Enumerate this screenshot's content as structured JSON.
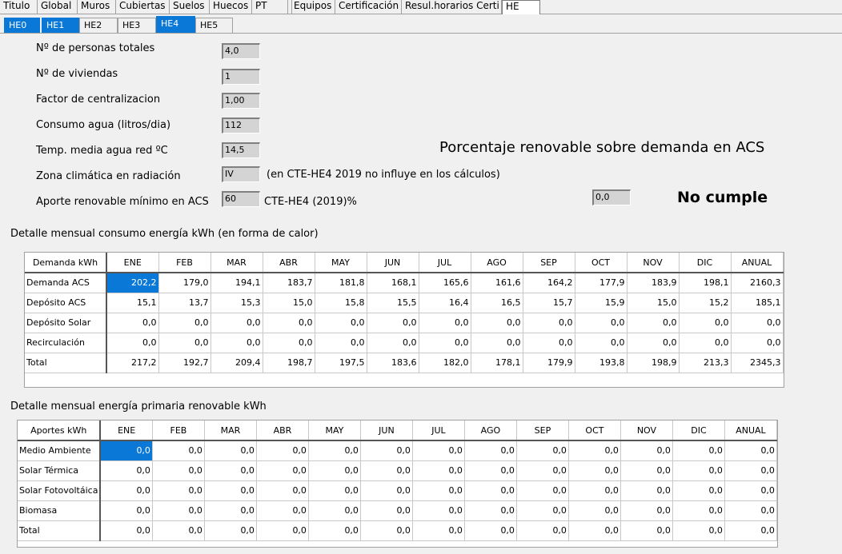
{
  "tabs_top": [
    {
      "label": "Titulo"
    },
    {
      "label": "Global"
    },
    {
      "label": "Muros"
    },
    {
      "label": "Cubiertas"
    },
    {
      "label": "Suelos"
    },
    {
      "label": "Huecos"
    },
    {
      "label": "PT"
    },
    {
      "label": ""
    },
    {
      "label": "Equipos"
    },
    {
      "label": "Certificación"
    },
    {
      "label": "Resul.horarios Certi"
    },
    {
      "label": "HE"
    }
  ],
  "tabs_he": [
    {
      "label": "HE0"
    },
    {
      "label": "HE1"
    },
    {
      "label": "HE2"
    },
    {
      "label": "HE3"
    },
    {
      "label": "HE4"
    },
    {
      "label": "HE5"
    }
  ],
  "form": {
    "personas_label": "Nº de personas totales",
    "personas_value": "4,0",
    "viviendas_label": "Nº de viviendas",
    "viviendas_value": "1",
    "factor_label": "Factor de centralizacion",
    "factor_value": "1,00",
    "consumo_label": "Consumo agua (litros/dia)",
    "consumo_value": "112",
    "temp_label": "Temp. media agua red ºC",
    "temp_value": "14,5",
    "zona_label": "Zona climática en radiación",
    "zona_value": "IV",
    "zona_note": "(en CTE-HE4 2019 no influye en los cálculos)",
    "aporte_label": "Aporte renovable mínimo en ACS",
    "aporte_value": "60",
    "aporte_note": "CTE-HE4 (2019)%"
  },
  "result": {
    "title": "Porcentaje renovable sobre demanda en ACS",
    "value": "0,0",
    "status": "No cumple"
  },
  "table1": {
    "title": "Detalle mensual consumo energía kWh (en forma de calor)",
    "corner": "Demanda kWh",
    "columns": [
      "ENE",
      "FEB",
      "MAR",
      "ABR",
      "MAY",
      "JUN",
      "JUL",
      "AGO",
      "SEP",
      "OCT",
      "NOV",
      "DIC",
      "ANUAL"
    ],
    "rows": [
      {
        "label": "Demanda ACS",
        "values": [
          "202,2",
          "179,0",
          "194,1",
          "183,7",
          "181,8",
          "168,1",
          "165,6",
          "161,6",
          "164,2",
          "177,9",
          "183,9",
          "198,1",
          "2160,3"
        ]
      },
      {
        "label": "Depósito ACS",
        "values": [
          "15,1",
          "13,7",
          "15,3",
          "15,0",
          "15,8",
          "15,5",
          "16,4",
          "16,5",
          "15,7",
          "15,9",
          "15,0",
          "15,2",
          "185,1"
        ]
      },
      {
        "label": "Depósito Solar",
        "values": [
          "0,0",
          "0,0",
          "0,0",
          "0,0",
          "0,0",
          "0,0",
          "0,0",
          "0,0",
          "0,0",
          "0,0",
          "0,0",
          "0,0",
          "0,0"
        ]
      },
      {
        "label": "Recirculación",
        "values": [
          "0,0",
          "0,0",
          "0,0",
          "0,0",
          "0,0",
          "0,0",
          "0,0",
          "0,0",
          "0,0",
          "0,0",
          "0,0",
          "0,0",
          "0,0"
        ]
      },
      {
        "label": "Total",
        "values": [
          "217,2",
          "192,7",
          "209,4",
          "198,7",
          "197,5",
          "183,6",
          "182,0",
          "178,1",
          "179,9",
          "193,8",
          "198,9",
          "213,3",
          "2345,3"
        ]
      }
    ]
  },
  "table2": {
    "title": "Detalle mensual energía primaria renovable kWh",
    "corner": "Aportes kWh",
    "columns": [
      "ENE",
      "FEB",
      "MAR",
      "ABR",
      "MAY",
      "JUN",
      "JUL",
      "AGO",
      "SEP",
      "OCT",
      "NOV",
      "DIC",
      "ANUAL"
    ],
    "rows": [
      {
        "label": "Medio Ambiente",
        "values": [
          "0,0",
          "0,0",
          "0,0",
          "0,0",
          "0,0",
          "0,0",
          "0,0",
          "0,0",
          "0,0",
          "0,0",
          "0,0",
          "0,0",
          "0,0"
        ]
      },
      {
        "label": "Solar Térmica",
        "values": [
          "0,0",
          "0,0",
          "0,0",
          "0,0",
          "0,0",
          "0,0",
          "0,0",
          "0,0",
          "0,0",
          "0,0",
          "0,0",
          "0,0",
          "0,0"
        ]
      },
      {
        "label": "Solar Fotovoltáica",
        "values": [
          "0,0",
          "0,0",
          "0,0",
          "0,0",
          "0,0",
          "0,0",
          "0,0",
          "0,0",
          "0,0",
          "0,0",
          "0,0",
          "0,0",
          "0,0"
        ]
      },
      {
        "label": "Biomasa",
        "values": [
          "0,0",
          "0,0",
          "0,0",
          "0,0",
          "0,0",
          "0,0",
          "0,0",
          "0,0",
          "0,0",
          "0,0",
          "0,0",
          "0,0",
          "0,0"
        ]
      },
      {
        "label": "Total",
        "values": [
          "0,0",
          "0,0",
          "0,0",
          "0,0",
          "0,0",
          "0,0",
          "0,0",
          "0,0",
          "0,0",
          "0,0",
          "0,0",
          "0,0",
          "0,0"
        ]
      }
    ]
  }
}
